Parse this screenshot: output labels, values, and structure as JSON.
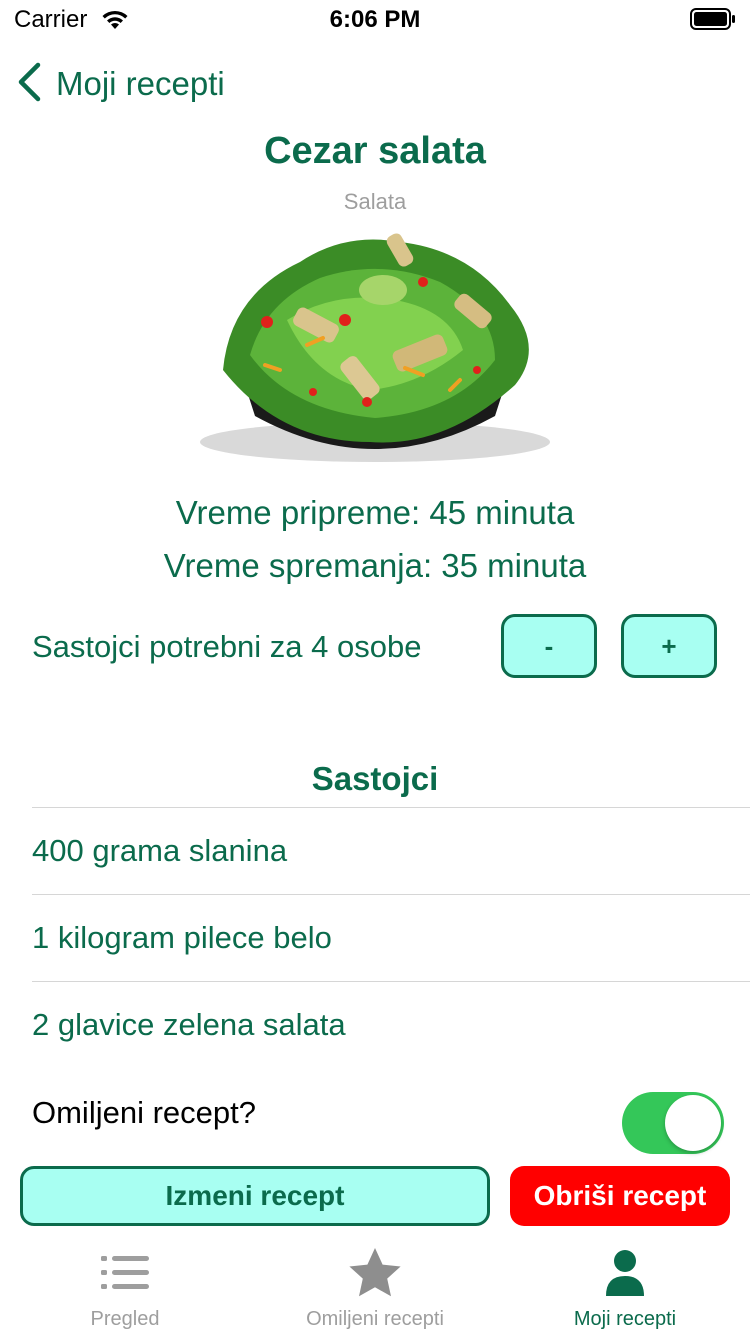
{
  "status_bar": {
    "carrier": "Carrier",
    "time": "6:06 PM"
  },
  "nav": {
    "back_label": "Moji recepti"
  },
  "recipe": {
    "title": "Cezar salata",
    "category": "Salata",
    "prep_time": "Vreme pripreme: 45 minuta",
    "cook_time": "Vreme spremanja: 35 minuta",
    "servings_text": "Sastojci potrebni za 4 osobe",
    "minus_label": "-",
    "plus_label": "+"
  },
  "ingredients": {
    "section_title": "Sastojci",
    "items": [
      "400 grama slanina",
      "1 kilogram pilece belo",
      "2 glavice zelena salata"
    ]
  },
  "favorite": {
    "label": "Omiljeni recept?",
    "on": true
  },
  "actions": {
    "edit_label": "Izmeni recept",
    "delete_label": "Obriši recept"
  },
  "tabbar": {
    "tabs": [
      {
        "label": "Pregled",
        "icon": "list-icon",
        "active": false
      },
      {
        "label": "Omiljeni recepti",
        "icon": "star-icon",
        "active": false
      },
      {
        "label": "Moji recepti",
        "icon": "person-icon",
        "active": true
      }
    ]
  },
  "colors": {
    "accent": "#0b6b4c",
    "button_fill": "#a8fff2",
    "delete": "#ff0000",
    "toggle_on": "#34c759",
    "inactive": "#9e9e9e"
  }
}
